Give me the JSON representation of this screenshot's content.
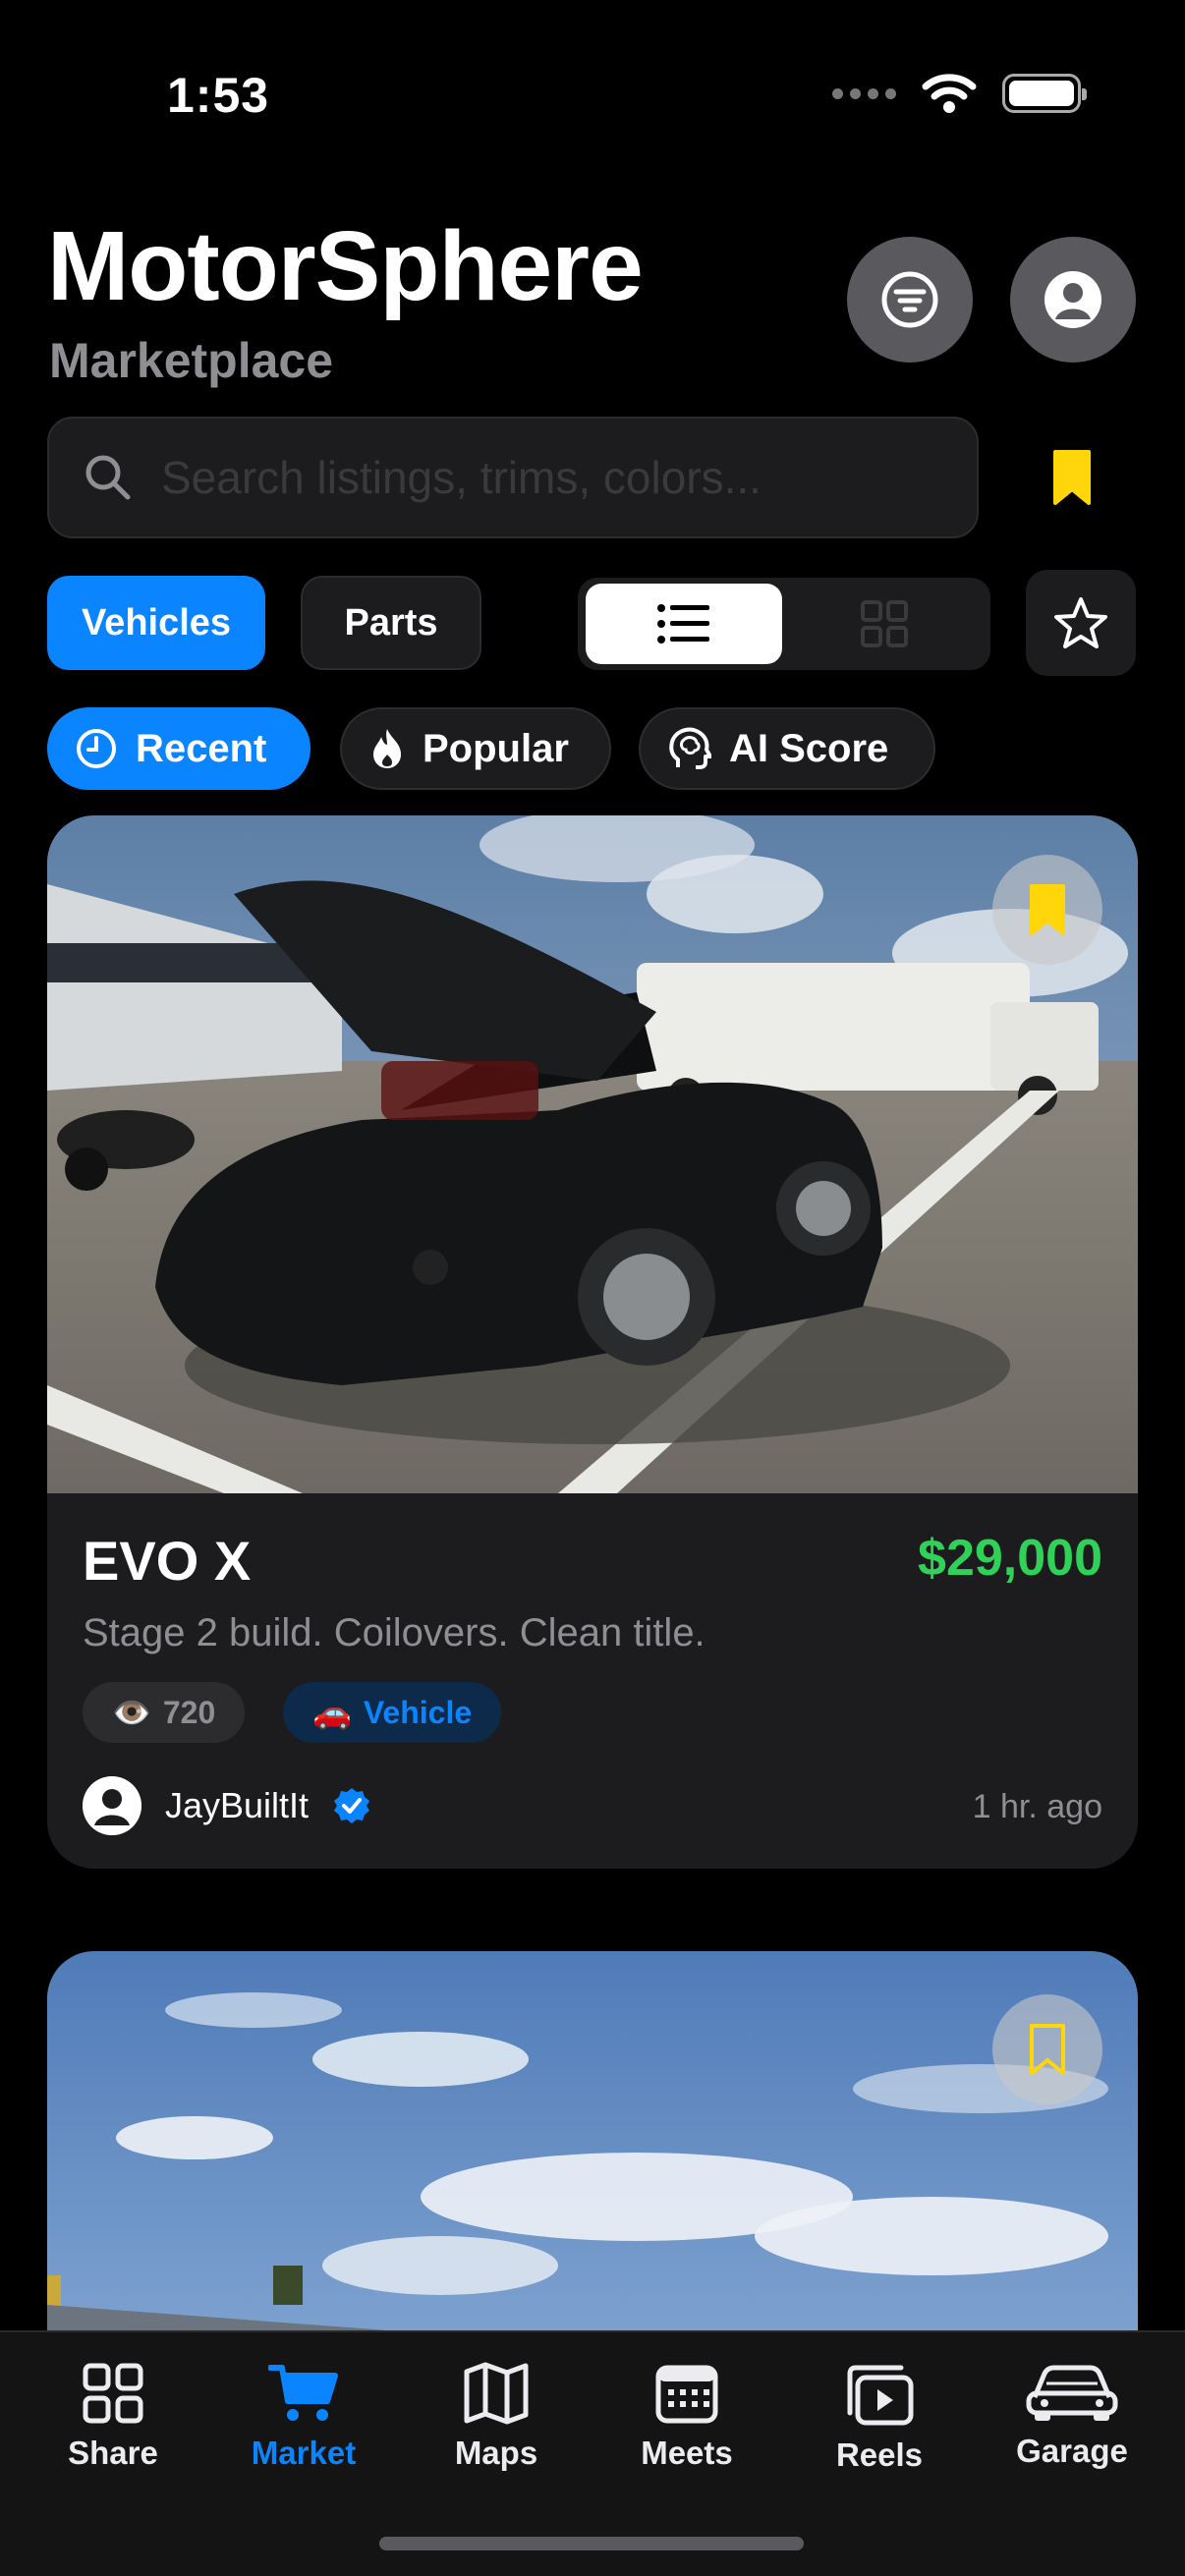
{
  "status": {
    "time": "1:53"
  },
  "header": {
    "title": "MotorSphere",
    "subtitle": "Marketplace"
  },
  "search": {
    "placeholder": "Search listings, trims, colors..."
  },
  "segments": {
    "vehicles": "Vehicles",
    "parts": "Parts"
  },
  "sort": {
    "recent": "Recent",
    "popular": "Popular",
    "ai": "AI Score"
  },
  "listings": [
    {
      "title": "EVO X",
      "price": "$29,000",
      "description": "Stage 2 build. Coilovers. Clean title.",
      "views": "720",
      "tag": "Vehicle",
      "seller": "JayBuiltIt",
      "time": "1 hr. ago"
    }
  ],
  "tabs": [
    {
      "label": "Share",
      "icon": "grid-icon"
    },
    {
      "label": "Market",
      "icon": "cart-icon"
    },
    {
      "label": "Maps",
      "icon": "map-icon"
    },
    {
      "label": "Meets",
      "icon": "calendar-icon"
    },
    {
      "label": "Reels",
      "icon": "play-icon"
    },
    {
      "label": "Garage",
      "icon": "car-icon"
    }
  ],
  "colors": {
    "accent": "#0a84ff",
    "price": "#30d158",
    "bookmark": "#ffd60a"
  }
}
